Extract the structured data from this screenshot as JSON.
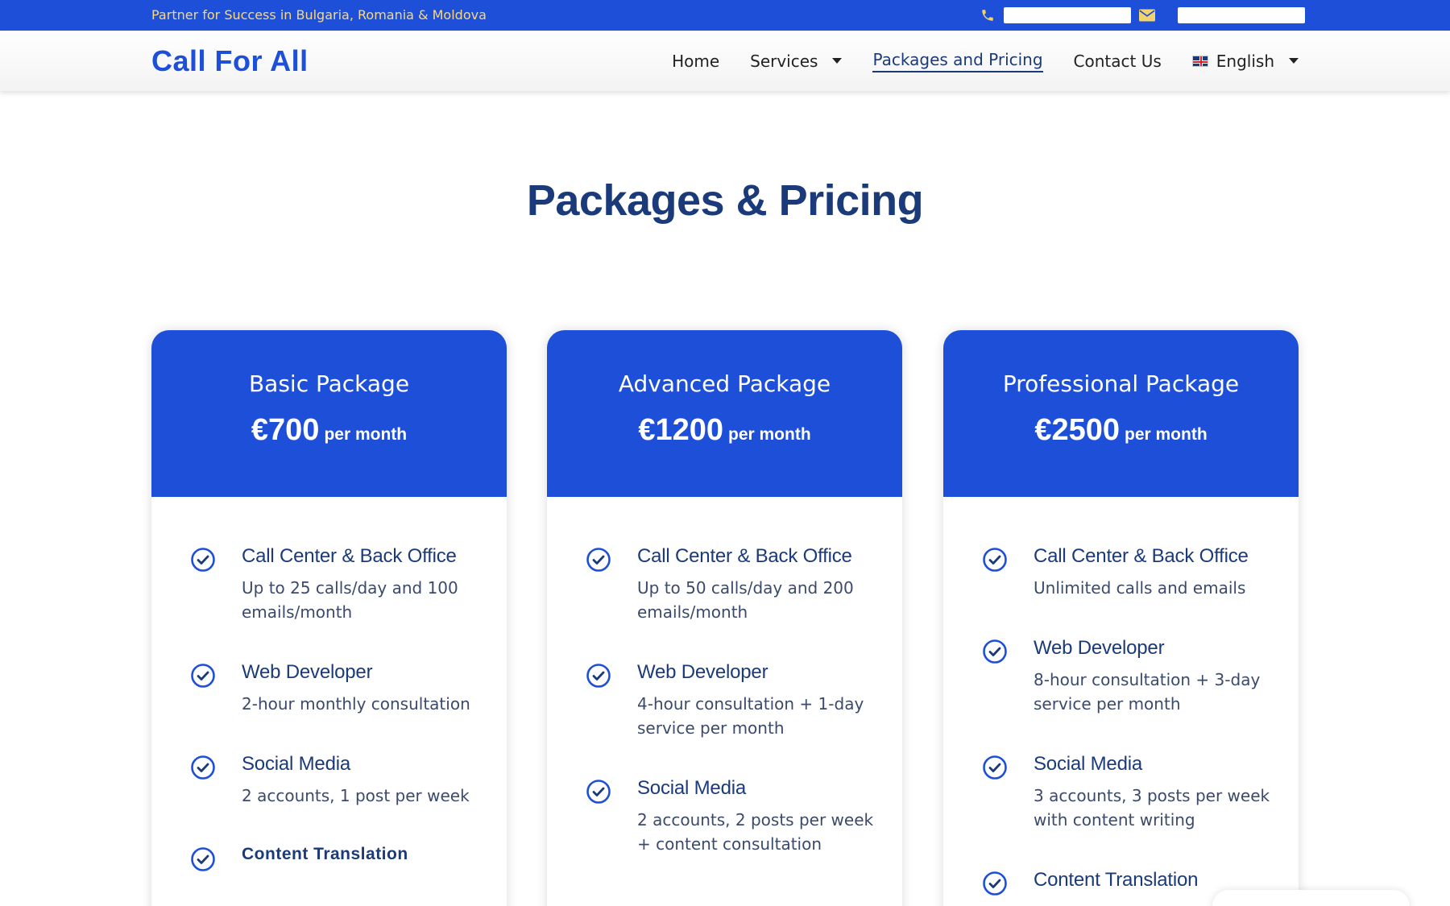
{
  "topbar": {
    "tagline": "Partner for Success in Bulgaria, Romania & Moldova",
    "icons": {
      "phone": "phone-icon",
      "email": "envelope-icon"
    },
    "colors": {
      "background": "#1e4fd8",
      "accent": "#f5d889"
    }
  },
  "header": {
    "logo": "Call For All",
    "nav": {
      "home": "Home",
      "services": "Services",
      "packages": "Packages and Pricing",
      "contact": "Contact Us",
      "language": "English"
    }
  },
  "page": {
    "title": "Packages & Pricing"
  },
  "cards": [
    {
      "name": "Basic Package",
      "price": "€700",
      "per": "per month",
      "features": [
        {
          "title": "Call Center & Back Office",
          "desc": "Up to 25 calls/day and 100 emails/month"
        },
        {
          "title": "Web Developer",
          "desc": "2-hour monthly consultation"
        },
        {
          "title": "Social Media",
          "desc": "2 accounts, 1 post per week"
        },
        {
          "title": "Content Translation",
          "desc": ""
        }
      ]
    },
    {
      "name": "Advanced Package",
      "price": "€1200",
      "per": "per month",
      "features": [
        {
          "title": "Call Center & Back Office",
          "desc": "Up to 50 calls/day and 200 emails/month"
        },
        {
          "title": "Web Developer",
          "desc": "4-hour consultation + 1-day service per month"
        },
        {
          "title": "Social Media",
          "desc": "2 accounts, 2 posts per week + content consultation"
        }
      ]
    },
    {
      "name": "Professional Package",
      "price": "€2500",
      "per": "per month",
      "features": [
        {
          "title": "Call Center & Back Office",
          "desc": "Unlimited calls and emails"
        },
        {
          "title": "Web Developer",
          "desc": "8-hour consultation + 3-day service per month"
        },
        {
          "title": "Social Media",
          "desc": "3 accounts, 3 posts per week with content writing"
        },
        {
          "title": "Content Translation",
          "desc": ""
        }
      ]
    }
  ],
  "icons": {
    "feature_check": "check-circle-icon",
    "language_flag": "uk-flag-icon",
    "dropdown": "caret-down-icon"
  },
  "colors": {
    "brand_blue": "#1e4fd8",
    "title_navy": "#1b3a7a"
  }
}
